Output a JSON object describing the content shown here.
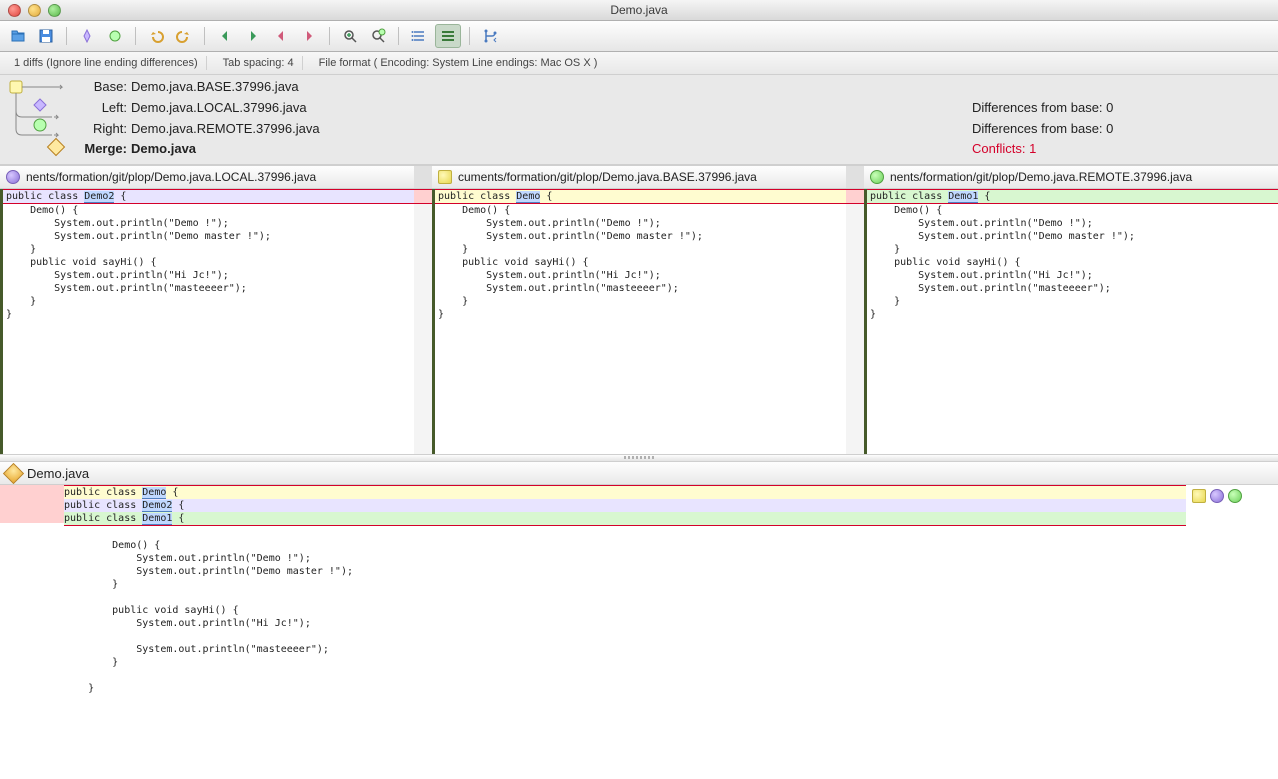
{
  "window": {
    "title": "Demo.java"
  },
  "toolbar": {
    "open": "open",
    "save": "save",
    "accept": "accept",
    "reject": "reject",
    "undo": "undo",
    "redo": "redo",
    "prev": "prev",
    "next": "next",
    "prev2": "prev-conflict",
    "next2": "next-conflict",
    "zoom_in": "zoom-in",
    "zoom_out": "zoom-out",
    "list": "list",
    "tree": "tree",
    "branch": "branch"
  },
  "infobar": {
    "diffs": "1 diffs (Ignore line ending differences)",
    "tabs": "Tab spacing: 4",
    "format": "File format ( Encoding: System  Line endings: Mac OS X )"
  },
  "summary": {
    "base": {
      "label": "Base:",
      "file": "Demo.java.BASE.37996.java"
    },
    "left": {
      "label": "Left:",
      "file": "Demo.java.LOCAL.37996.java",
      "diff": "Differences from base: 0"
    },
    "right": {
      "label": "Right:",
      "file": "Demo.java.REMOTE.37996.java",
      "diff": "Differences from base: 0"
    },
    "merge": {
      "label": "Merge:",
      "file": "Demo.java"
    },
    "conflicts": "Conflicts: 1"
  },
  "panes": {
    "left": {
      "path": "nents/formation/git/plop/Demo.java.LOCAL.37996.java"
    },
    "base": {
      "path": "cuments/formation/git/plop/Demo.java.BASE.37996.java"
    },
    "right": {
      "path": "nents/formation/git/plop/Demo.java.REMOTE.37996.java"
    }
  },
  "code": {
    "left_first": "public class Demo2 {",
    "base_first": "public class Demo {",
    "right_first": "public class Demo1 {",
    "left_mark": "Demo2",
    "base_mark": "Demo",
    "right_mark": "Demo1",
    "body": [
      "",
      "    Demo() {",
      "        System.out.println(\"Demo !\");",
      "        System.out.println(\"Demo master !\");",
      "    }",
      "",
      "    public void sayHi() {",
      "        System.out.println(\"Hi Jc!\");",
      "",
      "        System.out.println(\"masteeeer\");",
      "    }",
      "",
      "}"
    ]
  },
  "merge": {
    "header": "Demo.java",
    "lines_base": "public class Demo {",
    "lines_left": "public class Demo2 {",
    "lines_right": "public class Demo1 {"
  }
}
